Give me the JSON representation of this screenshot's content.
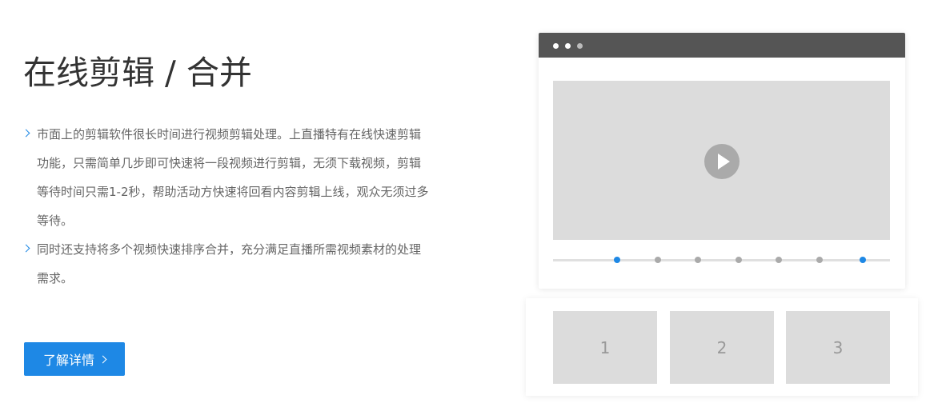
{
  "title": "在线剪辑 / 合并",
  "features": [
    "市面上的剪辑软件很长时间进行视频剪辑处理。上直播特有在线快速剪辑功能，只需简单几步即可快速将一段视频进行剪辑，无须下载视频，剪辑等待时间只需1-2秒，帮助活动方快速将回看内容剪辑上线，观众无须过多等待。",
    "同时还支持将多个视频快速排序合并，充分满足直播所需视频素材的处理需求。"
  ],
  "cta": {
    "label": "了解详情",
    "icon": "chevron-right-icon"
  },
  "illustration": {
    "window_dots": [
      "#ffffff",
      "#ffffff",
      "#bbbbbb"
    ],
    "play_icon": "play-icon",
    "timeline_markers": [
      {
        "position": 0.19,
        "color": "#1e88e5"
      },
      {
        "position": 0.31,
        "color": "#aaaaaa"
      },
      {
        "position": 0.43,
        "color": "#aaaaaa"
      },
      {
        "position": 0.55,
        "color": "#aaaaaa"
      },
      {
        "position": 0.67,
        "color": "#aaaaaa"
      },
      {
        "position": 0.79,
        "color": "#aaaaaa"
      },
      {
        "position": 0.92,
        "color": "#1e88e5"
      }
    ],
    "clips": [
      "1",
      "2",
      "3"
    ]
  },
  "colors": {
    "accent": "#1e88e5",
    "title": "#333333",
    "body_text": "#666666",
    "placeholder": "#dcdcdc",
    "window_bar": "#555555"
  }
}
